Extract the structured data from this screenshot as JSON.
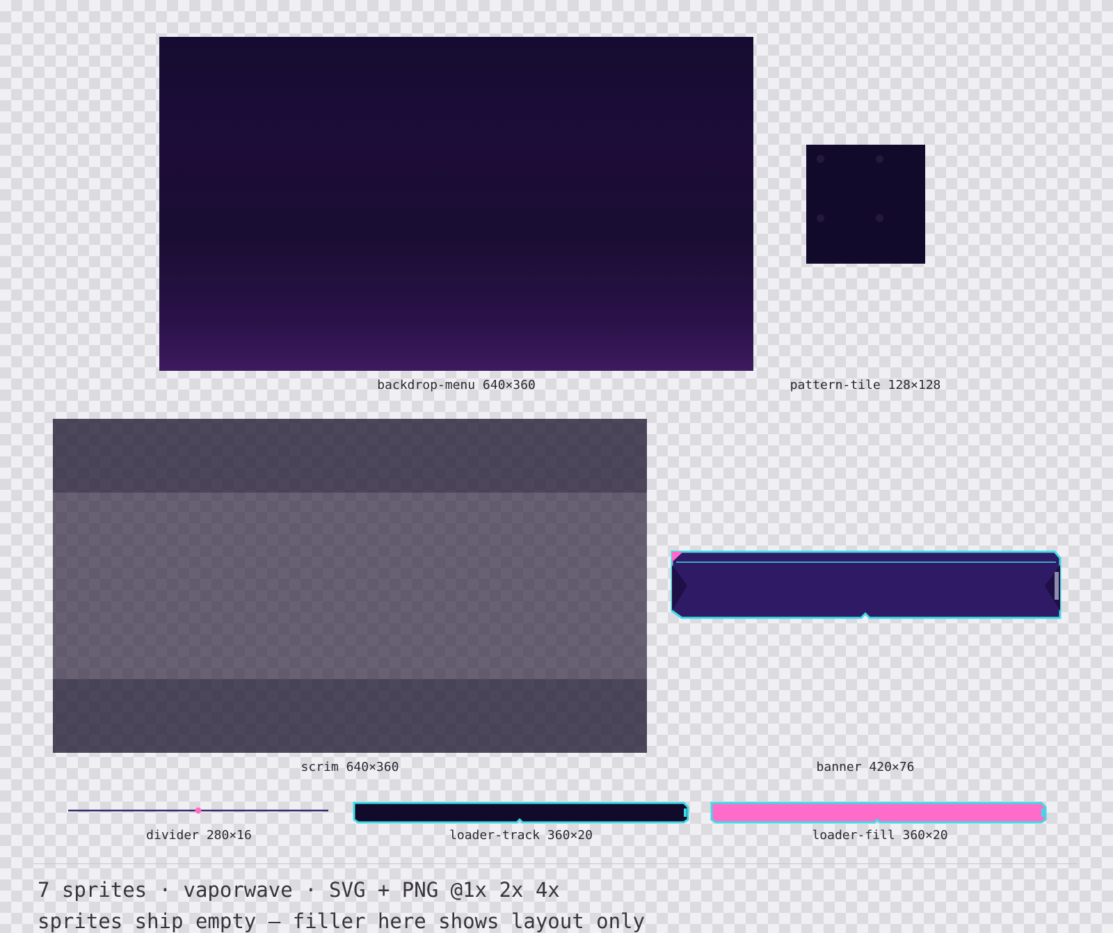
{
  "sprites": {
    "backdrop": {
      "name": "backdrop-menu",
      "size": "640×360"
    },
    "pattern": {
      "name": "pattern-tile",
      "size": "128×128"
    },
    "scrim": {
      "name": "scrim",
      "size": "640×360"
    },
    "banner": {
      "name": "banner",
      "size": "420×76"
    },
    "divider": {
      "name": "divider",
      "size": "280×16"
    },
    "loader_track": {
      "name": "loader-track",
      "size": "360×20"
    },
    "loader_fill": {
      "name": "loader-fill",
      "size": "360×20"
    }
  },
  "labels": {
    "backdrop": "backdrop-menu 640×360",
    "pattern": "pattern-tile 128×128",
    "scrim": "scrim 640×360",
    "banner": "banner 420×76",
    "divider": "divider 280×16",
    "loader_track": "loader-track 360×20",
    "loader_fill": "loader-fill 360×20"
  },
  "footer": {
    "line1": "7 sprites · vaporwave · SVG + PNG @1x 2x 4x",
    "line2": "sprites ship empty — filler here shows layout only"
  },
  "colors": {
    "background": "#f0eff3",
    "checker": "#dcdbe0",
    "deep_purple": "#160c31",
    "violet": "#2f1a66",
    "cyan_accent": "#3ddbe6",
    "pink_accent": "#ff6bc8",
    "navy": "#120a2b"
  }
}
